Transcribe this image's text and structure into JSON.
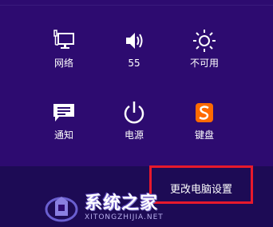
{
  "tiles": [
    {
      "label": "网络",
      "icon": "network-icon"
    },
    {
      "label": "55",
      "icon": "volume-icon"
    },
    {
      "label": "不可用",
      "icon": "brightness-icon"
    },
    {
      "label": "通知",
      "icon": "notifications-icon"
    },
    {
      "label": "电源",
      "icon": "power-icon"
    },
    {
      "label": "键盘",
      "icon": "keyboard-ime-icon"
    }
  ],
  "change_settings_label": "更改电脑设置",
  "watermark": {
    "text": "系统之家",
    "url": "XITONGZHIJIA.NET"
  },
  "colors": {
    "panel_background": "#2d0b70",
    "footer_background": "#1d0b55",
    "highlight_border": "#e8192c",
    "ime_icon": "#ff6a00"
  }
}
